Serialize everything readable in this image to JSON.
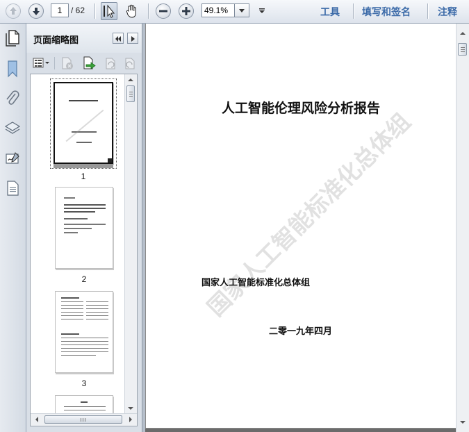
{
  "toolbar": {
    "page_current": "1",
    "page_total": "/ 62",
    "zoom": "49.1%",
    "tools_label": "工具",
    "sign_label": "填写和签名",
    "comment_label": "注释"
  },
  "panel": {
    "title": "页面缩略图"
  },
  "thumbnails": [
    {
      "number": "1"
    },
    {
      "number": "2"
    },
    {
      "number": "3"
    }
  ],
  "document": {
    "title": "人工智能伦理风险分析报告",
    "organization": "国家人工智能标准化总体组",
    "date": "二零一九年四月",
    "watermark": "国家人工智能标准化总体组"
  },
  "icons": [
    "arrow-up-icon",
    "arrow-down-icon",
    "select-cursor-icon",
    "hand-icon",
    "zoom-out-icon",
    "zoom-in-icon",
    "chevron-down-icon",
    "pages-icon",
    "bookmark-icon",
    "paperclip-icon",
    "layers-icon",
    "signature-icon",
    "document-icon"
  ],
  "colors": {
    "accent": "#3b6aa8"
  }
}
